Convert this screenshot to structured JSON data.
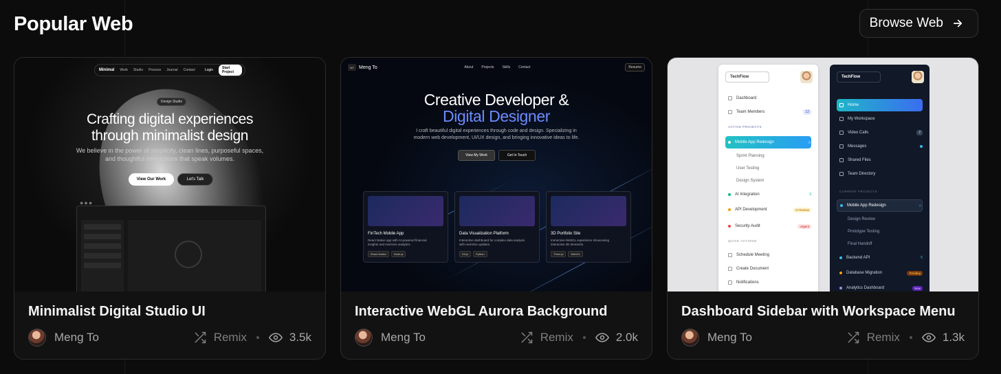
{
  "header": {
    "title": "Popular Web",
    "browse_label": "Browse Web"
  },
  "cards": [
    {
      "title": "Minimalist Digital Studio UI",
      "author": "Meng To",
      "remix_label": "Remix",
      "views": "3.5k",
      "thumb": {
        "brand": "Minimal",
        "nav": [
          "Work",
          "Studio",
          "Process",
          "Journal",
          "Contact"
        ],
        "login": "Login",
        "cta": "Start Project",
        "pill": "Design Studio",
        "hero_line1": "Crafting digital experiences",
        "hero_line2": "through minimalist design",
        "sub_line1": "We believe in the power of simplicity, clean lines, purposeful spaces,",
        "sub_line2": "and thoughtful interactions that speak volumes.",
        "btn_primary": "View Our Work",
        "btn_secondary": "Let's Talk"
      }
    },
    {
      "title": "Interactive WebGL Aurora Background",
      "author": "Meng To",
      "remix_label": "Remix",
      "views": "2.0k",
      "thumb": {
        "badge": "MT",
        "name": "Meng To",
        "nav": [
          "About",
          "Projects",
          "Skills",
          "Contact"
        ],
        "resume": "Resume",
        "hero_line1": "Creative Developer &",
        "hero_line2": "Digital Designer",
        "sub_line1": "I craft beautiful digital experiences through code and design. Specializing in",
        "sub_line2": "modern web development, UI/UX design, and bringing innovative ideas to life.",
        "btn_primary": "View My Work",
        "btn_secondary": "Get In Touch",
        "projects": [
          {
            "title": "FinTech Mobile App",
            "desc1": "React Native app with AI-powered financial",
            "desc2": "insights and real-time analytics.",
            "tags": [
              "React Native",
              "Node.js"
            ]
          },
          {
            "title": "Data Visualization Platform",
            "desc1": "Interactive dashboard for complex data analysis",
            "desc2": "with real-time updates.",
            "tags": [
              "D3.js",
              "Python"
            ]
          },
          {
            "title": "3D Portfolio Site",
            "desc1": "Immersive WebGL experience showcasing",
            "desc2": "interactive 3D elements.",
            "tags": [
              "Three.js",
              "WebGL"
            ]
          }
        ]
      }
    },
    {
      "title": "Dashboard Sidebar with Workspace Menu",
      "author": "Meng To",
      "remix_label": "Remix",
      "views": "1.3k",
      "thumb": {
        "brand": "TechFlow",
        "light": {
          "dashboard": "Dashboard",
          "team": "Team Members",
          "team_count": "12",
          "section_active": "ACTIVE PROJECTS",
          "active_item": "Mobile App Redesign",
          "sub1": "Sprint Planning",
          "sub2": "User Testing",
          "sub3": "Design System",
          "ai": "AI Integration",
          "ai_count": "3",
          "api": "API Development",
          "api_badge": "In Review",
          "security": "Security Audit",
          "security_badge": "Urgent",
          "section_quick": "QUICK ACTIONS",
          "q1": "Schedule Meeting",
          "q2": "Create Document",
          "q3": "Notifications"
        },
        "dark": {
          "home": "Home",
          "workspace": "My Workspace",
          "video": "Video Calls",
          "video_count": "2",
          "messages": "Messages",
          "shared": "Shared Files",
          "directory": "Team Directory",
          "section_current": "CURRENT PROJECTS",
          "active_item": "Mobile App Redesign",
          "sub1": "Design Review",
          "sub2": "Prototype Testing",
          "sub3": "Final Handoff",
          "backend": "Backend API",
          "backend_count": "5",
          "db": "Database Migration",
          "db_badge": "Pending",
          "analytics": "Analytics Dashboard",
          "analytics_badge": "New"
        }
      }
    }
  ]
}
